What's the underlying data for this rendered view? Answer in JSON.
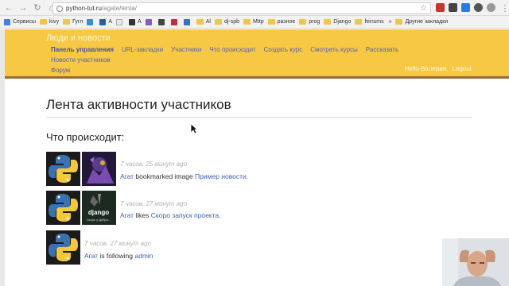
{
  "browser": {
    "url_host": "python-tut.ru",
    "url_path": "/agate/lenta/",
    "bookmarks": [
      "Сервисы",
      "kivy",
      "Гугл",
      "",
      "A",
      "",
      "A",
      "",
      "",
      "",
      "",
      "Al",
      "dj-spb",
      "Mttp",
      "разное",
      "prog",
      "Django",
      "feinsms"
    ],
    "other_bookmarks": "Другие закладки"
  },
  "site": {
    "title": "Люди и новости",
    "nav": [
      "Панель управления",
      "URL-закладки",
      "Участники",
      "Что происходит",
      "Создать курс",
      "Смотреть курсы",
      "Рассказать",
      "Новости участников",
      "Форум"
    ],
    "greeting": "Hello Валерия.",
    "logout": "Logout"
  },
  "main": {
    "title": "Лента активности участников",
    "section": "Что происходит:",
    "items": [
      {
        "time": "7 часов, 25 минут ago",
        "user": "Агат",
        "verb": "bookmarked image",
        "target": "Пример новости",
        "end": "."
      },
      {
        "time": "7 часов, 27 минут ago",
        "user": "Агат",
        "verb": "likes",
        "target": "Скоро запуск проекта",
        "end": "."
      },
      {
        "time": "7 часов, 27 минут ago",
        "user": "Агат",
        "verb": "is following",
        "target": "admin",
        "end": ""
      }
    ],
    "thumb_text": {
      "django": "django",
      "caption": "Скоро у Добро..."
    }
  },
  "colors": {
    "header": "#f7c843",
    "header_border": "#9b6a3c",
    "link": "#3d61b5",
    "nav_link": "#5a5fb0",
    "timestamp": "#b2b2b2"
  }
}
